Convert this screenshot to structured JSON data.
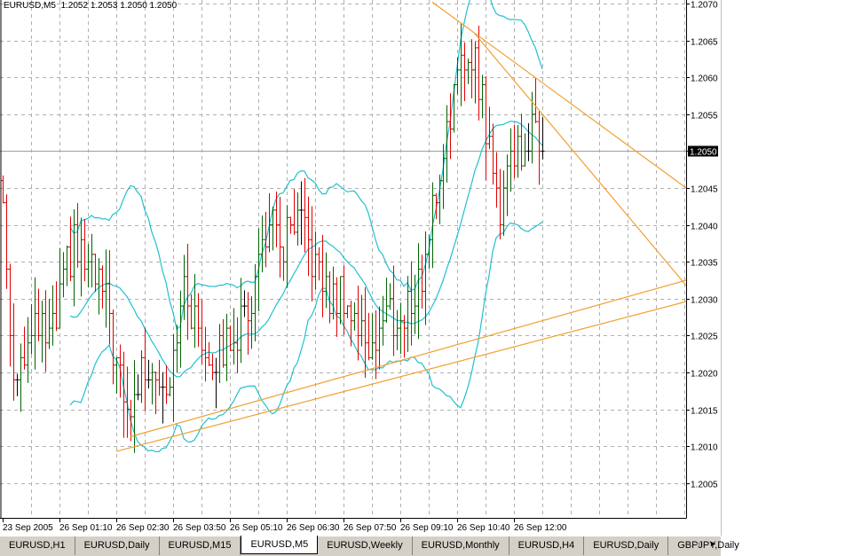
{
  "header": {
    "symbol": "EURUSD,M5",
    "ohlc": "1.2052 1.2053 1.2050 1.2050"
  },
  "tabs": [
    {
      "label": "EURUSD,H1",
      "active": false
    },
    {
      "label": "EURUSD,Daily",
      "active": false
    },
    {
      "label": "EURUSD,M15",
      "active": false
    },
    {
      "label": "EURUSD,M5",
      "active": true
    },
    {
      "label": "EURUSD,Weekly",
      "active": false
    },
    {
      "label": "EURUSD,Monthly",
      "active": false
    },
    {
      "label": "EURUSD,H4",
      "active": false
    },
    {
      "label": "EURUSD,Daily",
      "active": false
    },
    {
      "label": "GBPJPY,Daily",
      "active": false
    }
  ],
  "tab_arrows": {
    "left": "◄",
    "right": "►"
  },
  "colors": {
    "up": "#006400",
    "down": "#e00000",
    "flat": "#000000",
    "bands": "#20c0d0",
    "trendline": "#f0a030",
    "grid": "#b0b0b0"
  },
  "chart_data": {
    "type": "ohlc-bar",
    "title": "EURUSD,M5",
    "ylim": [
      1.2,
      1.2071
    ],
    "yticks": [
      "1.2070",
      "1.2065",
      "1.2060",
      "1.2055",
      "1.2050",
      "1.2045",
      "1.2040",
      "1.2035",
      "1.2030",
      "1.2025",
      "1.2020",
      "1.2015",
      "1.2010",
      "1.2005"
    ],
    "current_price": "1.2050",
    "bar_count": 153,
    "xlim_bars": [
      0,
      192.5
    ],
    "xticks": [
      {
        "bar": 0,
        "label": "23 Sep 2005"
      },
      {
        "bar": 16,
        "label": "26 Sep 01:10"
      },
      {
        "bar": 32,
        "label": "26 Sep 02:30"
      },
      {
        "bar": 48,
        "label": "26 Sep 03:50"
      },
      {
        "bar": 64,
        "label": "26 Sep 05:10"
      },
      {
        "bar": 80,
        "label": "26 Sep 06:30"
      },
      {
        "bar": 96,
        "label": "26 Sep 07:50"
      },
      {
        "bar": 112,
        "label": "26 Sep 09:10"
      },
      {
        "bar": 128,
        "label": "26 Sep 10:40"
      },
      {
        "bar": 144,
        "label": "26 Sep 12:00"
      }
    ],
    "close_samples": [
      1.2043,
      1.2021,
      1.2022,
      1.2024,
      1.2026,
      1.2024,
      1.2026,
      1.2032,
      1.2037,
      1.2036,
      1.2033,
      1.2032,
      1.2028,
      1.2022,
      1.2014,
      1.2016,
      1.202,
      1.2022,
      1.2019,
      1.2019,
      1.2027,
      1.2031,
      1.2027,
      1.2024,
      1.2022,
      1.2022,
      1.2025,
      1.2026,
      1.2028,
      1.2032,
      1.204,
      1.2039,
      1.2037,
      1.2038,
      1.204,
      1.2038,
      1.2034,
      1.2031,
      1.203,
      1.2031,
      1.2028,
      1.2025,
      1.2024,
      1.2025,
      1.2028,
      1.2027,
      1.2026,
      1.2031,
      1.2032,
      1.204,
      1.2046,
      1.2054,
      1.2058,
      1.2062,
      1.2064,
      1.2057,
      1.2049,
      1.2042,
      1.2049,
      1.205,
      1.2051,
      1.2052,
      1.205
    ],
    "indicator": {
      "name": "Bollinger Bands",
      "period": 20,
      "deviations": 2
    },
    "trendlines": [
      {
        "from": {
          "bar": 32,
          "price": 1.20093
        },
        "to": {
          "bar": 192.5,
          "price": 1.20296
        }
      },
      {
        "from": {
          "bar": 36,
          "price": 1.20113
        },
        "to": {
          "bar": 192.5,
          "price": 1.20325
        }
      },
      {
        "from": {
          "bar": 121,
          "price": 1.20702
        },
        "to": {
          "bar": 192.5,
          "price": 1.2045
        }
      },
      {
        "from": {
          "bar": 133,
          "price": 1.20659
        },
        "to": {
          "bar": 192.5,
          "price": 1.20318
        }
      }
    ]
  }
}
